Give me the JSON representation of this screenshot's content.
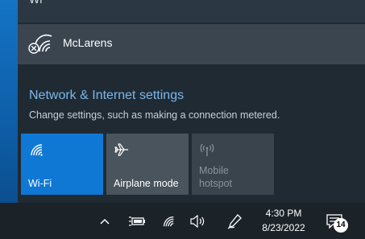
{
  "network_flyout": {
    "partial_network_label": "Wi",
    "networks": [
      {
        "name": "McLarens",
        "status_icon": "wifi-secured-x-icon"
      }
    ],
    "settings_link": "Network & Internet settings",
    "settings_description": "Change settings, such as making a connection metered."
  },
  "quick_actions": [
    {
      "label": "Wi-Fi",
      "icon": "wifi-icon",
      "state": "on",
      "color": "#0f78d4"
    },
    {
      "label": "Airplane mode",
      "icon": "airplane-icon",
      "state": "off"
    },
    {
      "label_line1": "Mobile",
      "label_line2": "hotspot",
      "icon": "hotspot-icon",
      "state": "disabled"
    }
  ],
  "taskbar": {
    "time": "4:30 PM",
    "date": "8/23/2022",
    "notification_count": "14",
    "tray_icons": [
      "chevron-up-icon",
      "battery-charging-icon",
      "wifi-icon",
      "volume-icon",
      "pen-icon",
      "action-center-icon"
    ]
  },
  "colors": {
    "accent": "#0f78d4",
    "link": "#7ab8ec",
    "panel": "#1f2a33"
  }
}
